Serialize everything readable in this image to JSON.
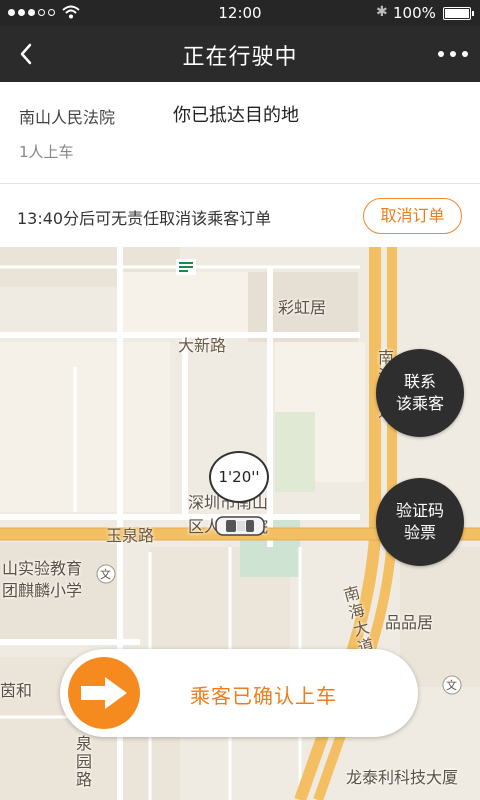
{
  "status_bar": {
    "time": "12:00",
    "battery": "100%"
  },
  "nav": {
    "title": "正在行驶中"
  },
  "trip": {
    "origin": "南山人民法院",
    "destination": "你已抵达目的地",
    "passengers": "1人上车"
  },
  "cancel": {
    "notice": "13:40分后可无责任取消该乘客订单",
    "button": "取消订单"
  },
  "map": {
    "labels": {
      "rainbow": "彩虹居",
      "daxin_road": "大新路",
      "court_line1": "深圳市南山",
      "court_line2": "区人民法院",
      "yuquan_road": "玉泉路",
      "school_line1": "山实验教育",
      "school_line2": "团麒麟小学",
      "pinpin": "品品居",
      "zhongherhe": "茵和",
      "nanhai": "南海大道",
      "nanhai_top": "南海大道",
      "longtai": "龙泰利科技大厦",
      "quanyuan": "泉园路",
      "wen": "文"
    },
    "timer": "1'20''"
  },
  "actions": {
    "contact_line1": "联系",
    "contact_line2": "该乘客",
    "verify_line1": "验证码",
    "verify_line2": "验票"
  },
  "confirm": {
    "label": "乘客已确认上车"
  },
  "colors": {
    "accent": "#f58a1f",
    "nav_bg": "#2b2b2b",
    "map_road_main": "#f6c56a"
  }
}
